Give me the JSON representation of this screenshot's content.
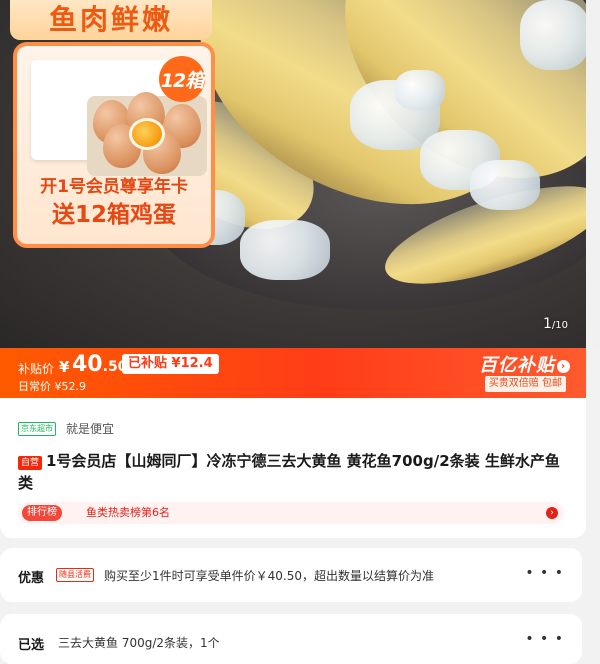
{
  "hero": {
    "promo_strip_text": "鱼肉鲜嫩",
    "promo_badge": "12箱",
    "promo_line1": "开1号会员尊享年卡",
    "promo_line2": "送12箱鸡蛋",
    "image_counter_current": "1",
    "image_counter_total": "/10"
  },
  "price_bar": {
    "subsidy_label": "补贴价",
    "currency": "¥",
    "price_int": "40",
    "price_dec": ".50",
    "subsidy_amount": "已补贴 ¥12.4",
    "daily_price": "日常价 ¥52.9",
    "subsidy_logo": "百亿补贴",
    "guarantee_tag": "买贵双倍赔 包邮"
  },
  "title_card": {
    "store_badge": "京东超市",
    "slogan": "就是便宜",
    "self_tag": "自营",
    "title": "1号会员店【山姆同厂】冷冻宁德三去大黄鱼 黄花鱼700g/2条装 生鲜水产鱼类",
    "rank_tag": "排行榜",
    "rank_text": "鱼类热卖榜第6名"
  },
  "offer_row": {
    "label": "优惠",
    "mini_tag": "随县活费",
    "text": "购买至少1件时可享受单件价￥40.50，超出数量以结算价为准",
    "more": "• • •"
  },
  "chosen_row": {
    "label": "已选",
    "text": "三去大黄鱼 700g/2条装，1个",
    "more": "• • •"
  },
  "colors": {
    "accent": "#ff3d18",
    "jd_green": "#1db95a",
    "rank_red": "#e2231a"
  }
}
